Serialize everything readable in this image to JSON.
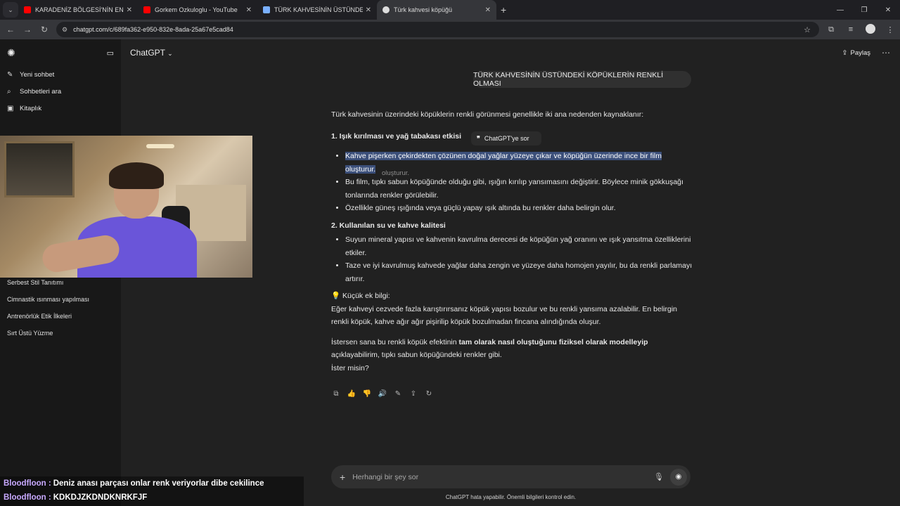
{
  "browser": {
    "tabs": [
      {
        "title": "KARADENİZ BÖLGESİ'NİN EN D",
        "favicon": "youtube-icon",
        "color": "#ff0000"
      },
      {
        "title": "Gorkem Ozkuloglu - YouTube",
        "favicon": "youtube-icon",
        "color": "#ff0000"
      },
      {
        "title": "TÜRK KAHVESİNİN ÜSTÜNDEKİ",
        "favicon": "pen-icon",
        "color": "#7ab0ff"
      },
      {
        "title": "Türk kahvesi köpüğü",
        "favicon": "chatgpt-icon",
        "color": "#dddddd"
      }
    ],
    "url": "chatgpt.com/c/689fa362-e950-832e-8ada-25a67e5cad84"
  },
  "sidebar": {
    "items": [
      {
        "label": "Yeni sohbet",
        "icon": "edit-icon"
      },
      {
        "label": "Sohbetleri ara",
        "icon": "search-icon"
      },
      {
        "label": "Kitaplık",
        "icon": "library-icon"
      }
    ],
    "chats": [
      "Serbest Stil Tanıtımı",
      "Cimnastik ısınması yapılması",
      "Antrenörlük Etik İlkeleri",
      "Sırt Üstü Yüzme"
    ]
  },
  "header": {
    "model": "ChatGPT",
    "share": "Paylaş"
  },
  "conversation": {
    "user_message": "TÜRK KAHVESİNİN ÜSTÜNDEKİ KÖPÜKLERİN RENKLİ OLMASI",
    "intro": "Türk kahvesinin üzerindeki köpüklerin renkli görünmesi genellikle iki ana nedenden kaynaklanır:",
    "section1_title": "1. Işık kırılması ve yağ tabakası etkisi",
    "section1_items": [
      "Kahve pişerken çekirdekten çözünen doğal yağlar yüzeye çıkar ve köpüğün üzerinde ince bir film oluşturur.",
      "Bu film, tıpkı sabun köpüğünde olduğu gibi, ışığın kırılıp yansımasını değiştirir. Böylece minik gökkuşağı tonlarında renkler görülebilir.",
      "Özellikle güneş ışığında veya güçlü yapay ışık altında bu renkler daha belirgin olur."
    ],
    "section2_title": "2. Kullanılan su ve kahve kalitesi",
    "section2_items": [
      "Suyun mineral yapısı ve kahvenin kavrulma derecesi de köpüğün yağ oranını ve ışık yansıtma özelliklerini etkiler.",
      "Taze ve iyi kavrulmuş kahvede yağlar daha zengin ve yüzeye daha homojen yayılır, bu da renkli parlamayı artırır."
    ],
    "tip_title": "Küçük ek bilgi:",
    "tip_text": "Eğer kahveyi cezvede fazla karıştırırsanız köpük yapısı bozulur ve bu renkli yansıma azalabilir. En belirgin renkli köpük, kahve ağır ağır pişirilip köpük bozulmadan fincana alındığında oluşur.",
    "closing_pre": "İstersen sana bu renkli köpük efektinin ",
    "closing_bold": "tam olarak nasıl oluştuğunu fiziksel olarak modelleyip",
    "closing_post": " açıklayabilirim, tıpkı sabun köpüğündeki renkler gibi.",
    "closing_q": "İster misin?",
    "tooltip": "ChatGPT'ye sor",
    "ghost_text": "oluşturur."
  },
  "composer": {
    "placeholder": "Herhangi bir şey sor"
  },
  "disclaimer": "ChatGPT hata yapabilir. Önemli bilgileri kontrol edin.",
  "stream_chat": [
    {
      "user": "Bloodfloon",
      "message": "Deniz anası parçası onlar renk veriyorlar dibe cekilince"
    },
    {
      "user": "Bloodfloon",
      "message": "KDKDJZKDNDKNRKFJF"
    }
  ]
}
